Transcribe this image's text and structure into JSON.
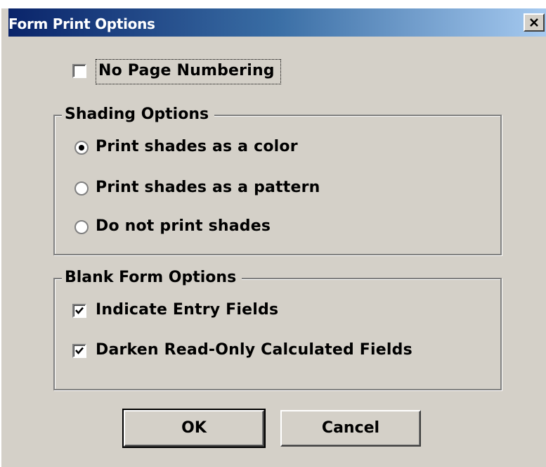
{
  "window": {
    "title": "Form Print Options",
    "close_label": "×"
  },
  "no_page_numbering": {
    "label": "No Page Numbering",
    "checked": false
  },
  "shading": {
    "title": "Shading Options",
    "options": [
      {
        "label": "Print shades as a color",
        "selected": true
      },
      {
        "label": "Print shades as a pattern",
        "selected": false
      },
      {
        "label": "Do not print shades",
        "selected": false
      }
    ]
  },
  "blank_form": {
    "title": "Blank Form Options",
    "options": [
      {
        "label": "Indicate Entry Fields",
        "checked": true
      },
      {
        "label": "Darken Read-Only Calculated Fields",
        "checked": true
      }
    ]
  },
  "buttons": {
    "ok": "OK",
    "cancel": "Cancel"
  }
}
